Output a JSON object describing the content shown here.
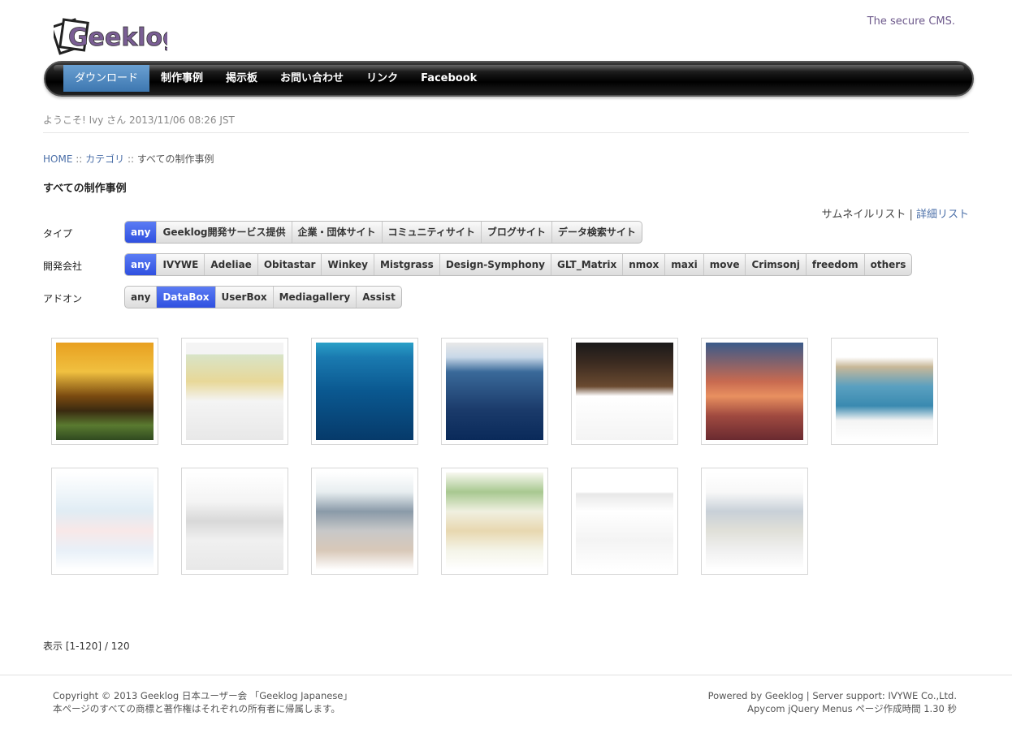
{
  "header": {
    "logo_text": "Geeklog",
    "tagline": "The secure CMS."
  },
  "nav": [
    {
      "label": "ダウンロード",
      "active": true
    },
    {
      "label": "制作事例",
      "active": false
    },
    {
      "label": "掲示板",
      "active": false
    },
    {
      "label": "お問い合わせ",
      "active": false
    },
    {
      "label": "リンク",
      "active": false
    },
    {
      "label": "Facebook",
      "active": false
    }
  ],
  "welcome": "ようこそ! Ivy さん 2013/11/06 08:26 JST",
  "breadcrumb": {
    "home": "HOME",
    "sep1": " :: ",
    "category": "カテゴリ",
    "sep2": " :: ",
    "current": "すべての制作事例"
  },
  "page_title": "すべての制作事例",
  "view_links": {
    "thumbnail": "サムネイルリスト",
    "separator": " | ",
    "detail": "詳細リスト"
  },
  "filters": [
    {
      "label": "タイプ",
      "options": [
        "any",
        "Geeklog開発サービス提供",
        "企業・団体サイト",
        "コミュニティサイト",
        "ブログサイト",
        "データ検索サイト"
      ],
      "selected": 0
    },
    {
      "label": "開発会社",
      "options": [
        "any",
        "IVYWE",
        "Adeliae",
        "Obitastar",
        "Winkey",
        "Mistgrass",
        "Design-Symphony",
        "GLT_Matrix",
        "nmox",
        "maxi",
        "move",
        "Crimsonj",
        "freedom",
        "others"
      ],
      "selected": 0
    },
    {
      "label": "アドオン",
      "options": [
        "any",
        "DataBox",
        "UserBox",
        "Mediagallery",
        "Assist"
      ],
      "selected": 1
    }
  ],
  "thumbnails": [
    {
      "name": "thumb-amanasia"
    },
    {
      "name": "thumb-map-site"
    },
    {
      "name": "thumb-diving"
    },
    {
      "name": "thumb-incredible-india"
    },
    {
      "name": "thumb-hotel-site"
    },
    {
      "name": "thumb-hawaii-mice"
    },
    {
      "name": "thumb-global-travel"
    },
    {
      "name": "thumb-school-site"
    },
    {
      "name": "thumb-portal-site"
    },
    {
      "name": "thumb-bus-site"
    },
    {
      "name": "thumb-community-site"
    },
    {
      "name": "thumb-geeklog-japanese"
    },
    {
      "name": "thumb-map-search"
    }
  ],
  "result_count": "表示 [1-120] / 120",
  "footer": {
    "copyright": "Copyright © 2013 Geeklog 日本ユーザー会 「Geeklog Japanese」",
    "rights": "本ページのすべての商標と著作権はそれぞれの所有者に帰属します。",
    "powered": "Powered by Geeklog | Server support: IVYWE Co.,Ltd.",
    "menus": "Apycom jQuery Menus ページ作成時間 1.30 秒"
  },
  "colors": {
    "link": "#4b6fa8",
    "selected_filter": "#3a5ae8",
    "nav_active": "#4f88c2",
    "tagline": "#6e5a8c"
  }
}
